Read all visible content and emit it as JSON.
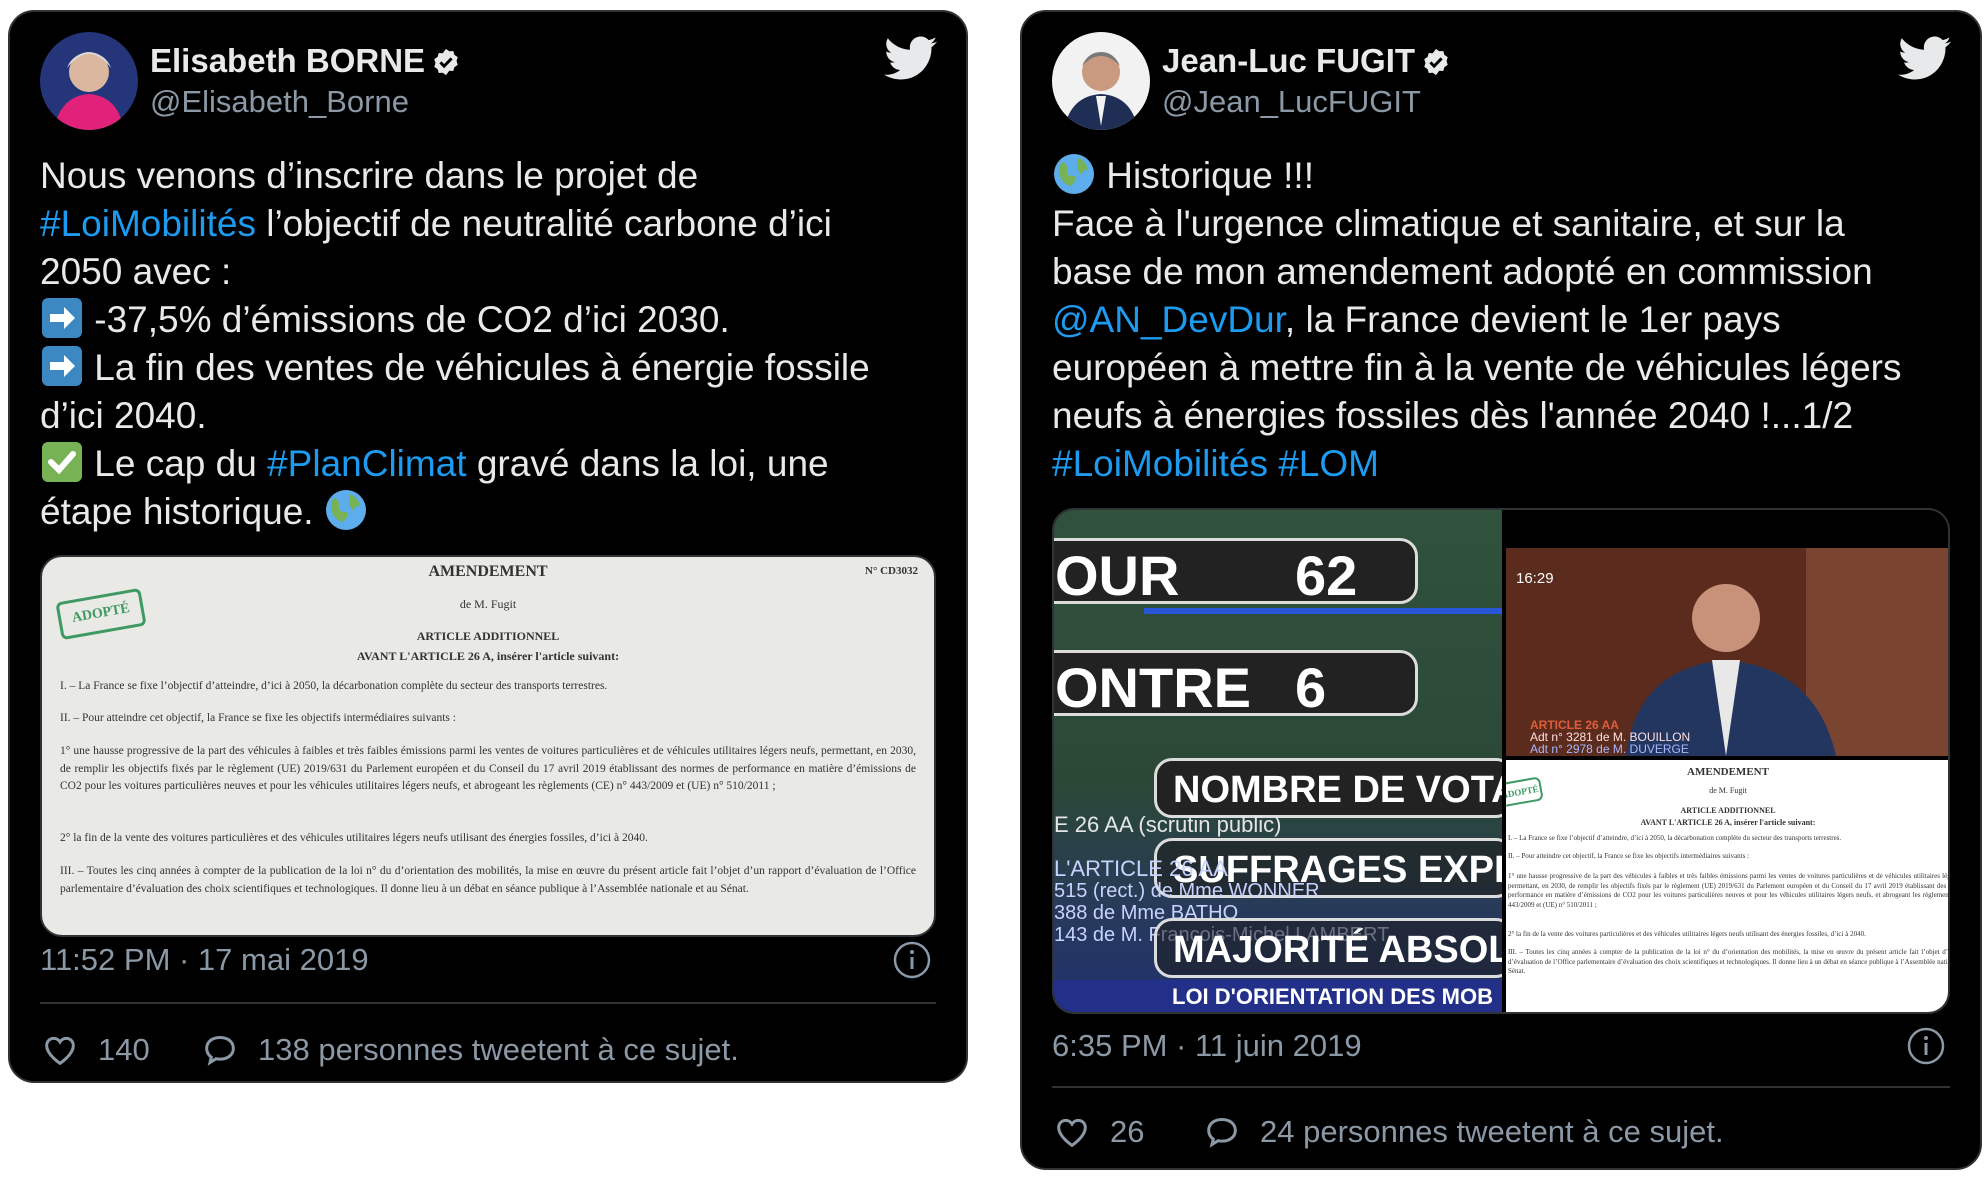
{
  "tweets": [
    {
      "author_name": "Elisabeth BORNE",
      "author_handle": "@Elisabeth_Borne",
      "text": {
        "line1": "Nous venons d’inscrire dans le projet de",
        "line2_hashtag": "#LoiMobilités",
        "line2_rest": " l’objectif de neutralité carbone d’ici",
        "line3": "2050 avec :",
        "line4": " -37,5% d’émissions de CO2 d’ici 2030.",
        "line5": " La fin des ventes de véhicules à énergie fossile",
        "line6": "d’ici 2040.",
        "line7_a": " Le cap du ",
        "line7_hashtag": "#PlanClimat",
        "line7_b": " gravé dans la loi, une",
        "line8": "étape historique. "
      },
      "media": {
        "title": "AMENDEMENT",
        "number": "N° CD3032",
        "stamp": "ADOPTÉ",
        "author": "de M. Fugit",
        "article": "ARTICLE ADDITIONNEL",
        "subtitle": "AVANT L'ARTICLE 26 A, insérer l'article suivant:",
        "p1": "I. – La France se fixe l’objectif d’atteindre, d’ici à 2050, la décarbonation complète du secteur des transports terrestres.",
        "p2": "II. – Pour atteindre cet objectif, la France se fixe les objectifs intermédiaires suivants :",
        "p3": "1° une hausse progressive de la part des véhicules à faibles et très faibles émissions parmi les ventes de voitures particulières et de véhicules utilitaires légers neufs, permettant, en 2030, de remplir les objectifs fixés par le règlement (UE) 2019/631 du Parlement européen et du Conseil du 17 avril 2019 établissant des normes de performance en matière d’émissions de CO2 pour les voitures particulières neuves et pour les véhicules utilitaires légers neufs, et abrogeant les règlements (CE) n° 443/2009 et (UE) n° 510/2011 ;",
        "p4": "2° la fin de la vente des voitures particulières et des véhicules utilitaires légers neufs utilisant des énergies fossiles, d’ici à 2040.",
        "p5": "III. – Toutes les cinq années à compter de la publication de la loi n°     du     d’orientation des mobilités, la mise en œuvre du présent article fait l’objet d’un rapport d’évaluation de l’Office parlementaire d’évaluation des choix scientifiques et technologiques. Il donne lieu à un débat en séance publique à l’Assemblée nationale et au Sénat."
      },
      "timestamp": "11:52 PM · 17 mai 2019",
      "likes": "140",
      "replies": "138 personnes tweetent à ce sujet."
    },
    {
      "author_name": "Jean-Luc FUGIT",
      "author_handle": "@Jean_LucFUGIT",
      "text": {
        "line1": " Historique !!!",
        "line2": "Face à l'urgence climatique et sanitaire, et sur la",
        "line3": "base de mon amendement adopté en commission",
        "line4_mention": "@AN_DevDur",
        "line4_rest": ", la France devient le 1er pays",
        "line5": "européen à mettre fin à la vente de véhicules légers",
        "line6": "neufs à énergies fossiles dès l'année 2040 !...1/2",
        "line7_hashtag1": "#LoiMobilités",
        "line7_hashtag2": "#LOM"
      },
      "media": {
        "vote_pour_label": "OUR",
        "vote_pour_value": "62",
        "vote_contre_label": "ONTRE",
        "vote_contre_value": "6",
        "nombre_votants": "NOMBRE DE VOTA",
        "scrutin": "E 26 AA (scrutin public)",
        "suffrages": "SUFFRAGES EXPR",
        "article_line": "L'ARTICLE 26 AA",
        "amend1": "515 (rect.) de Mme WONNER",
        "amend2": "388 de Mme BATHO",
        "amend3": "143 de M. François-Michel LAMBERT",
        "majorite": "MAJORITÉ ABSOL",
        "loi": "LOI D'ORIENTATION DES MOB",
        "video_time": "16:29",
        "video_article": "ARTICLE 26 AA",
        "video_adt1": "Adt n° 3281 de M. BOUILLON",
        "video_adt2": "Adt n° 2978 de M. DUVERGE",
        "doc_title": "AMENDEMENT",
        "doc_author": "de M. Fugit",
        "doc_article": "ARTICLE ADDITIONNEL",
        "doc_subtitle": "AVANT L'ARTICLE 26 A, insérer l'article suivant:",
        "doc_stamp": "ADOPTÉ"
      },
      "timestamp": "6:35 PM · 11 juin 2019",
      "likes": "26",
      "replies": "24 personnes tweetent à ce sujet."
    }
  ],
  "colors": {
    "background": "#000000",
    "text": "#e7e9ea",
    "secondary": "#8b98a5",
    "link": "#1d9bf0",
    "border": "#2f3336",
    "twitter_blue": "#ffffff"
  },
  "icons": [
    "verified-badge-icon",
    "twitter-bird-icon",
    "arrow-right-emoji-icon",
    "check-mark-emoji-icon",
    "globe-emoji-icon",
    "heart-icon",
    "reply-bubble-icon",
    "info-icon"
  ]
}
